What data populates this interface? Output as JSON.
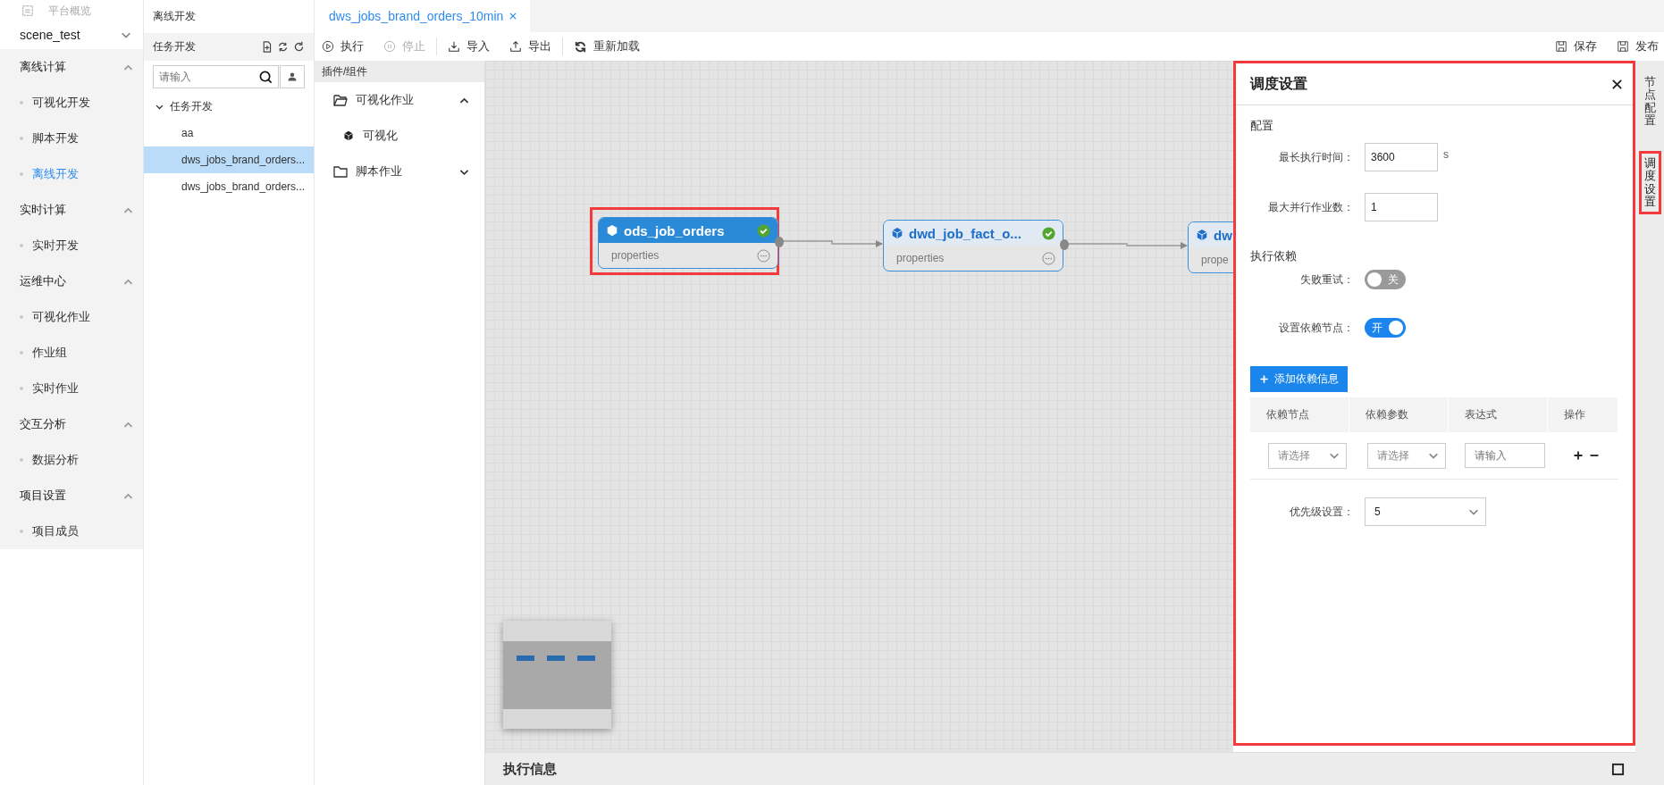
{
  "nav": {
    "overview": {
      "label": "平台概览",
      "disabled": true
    },
    "project": {
      "value": "scene_test"
    },
    "groups": [
      {
        "label": "离线计算",
        "expanded": true,
        "items": [
          {
            "label": "可视化开发",
            "selected": false
          },
          {
            "label": "脚本开发",
            "selected": false
          },
          {
            "label": "离线开发",
            "selected": true
          }
        ]
      },
      {
        "label": "实时计算",
        "expanded": true,
        "items": [
          {
            "label": "实时开发",
            "selected": false
          }
        ]
      },
      {
        "label": "运维中心",
        "expanded": true,
        "items": [
          {
            "label": "可视化作业",
            "selected": false
          },
          {
            "label": "作业组",
            "selected": false
          },
          {
            "label": "实时作业",
            "selected": false
          }
        ]
      },
      {
        "label": "交互分析",
        "expanded": true,
        "items": [
          {
            "label": "数据分析",
            "selected": false
          }
        ]
      },
      {
        "label": "项目设置",
        "expanded": true,
        "items": [
          {
            "label": "项目成员",
            "selected": false
          }
        ]
      }
    ]
  },
  "explorer": {
    "title": "离线开发",
    "section": "任务开发",
    "search": {
      "placeholder": "请输入"
    },
    "tree": [
      {
        "label": "任务开发",
        "expanded": true,
        "children": [
          {
            "label": "aa",
            "selected": false
          },
          {
            "label": "dws_jobs_brand_orders...",
            "selected": true
          },
          {
            "label": "dws_jobs_brand_orders...",
            "selected": false
          }
        ]
      }
    ]
  },
  "tabs": [
    {
      "label": "dws_jobs_brand_orders_10min",
      "selected": true
    }
  ],
  "toolbar": {
    "left": [
      [
        {
          "kind": "run",
          "label": "执行",
          "disabled": false
        },
        {
          "kind": "stop",
          "label": "停止",
          "disabled": true
        }
      ],
      [
        {
          "kind": "import",
          "label": "导入",
          "disabled": false
        },
        {
          "kind": "export",
          "label": "导出",
          "disabled": false
        }
      ],
      [
        {
          "kind": "reload",
          "label": "重新加载",
          "disabled": false
        }
      ]
    ],
    "right": [
      {
        "label": "保存"
      },
      {
        "label": "发布"
      }
    ]
  },
  "plugins": {
    "title": "插件/组件",
    "groups": [
      {
        "label": "可视化作业",
        "expanded": true,
        "items": [
          {
            "label": "可视化"
          }
        ]
      },
      {
        "label": "脚本作业",
        "expanded": false
      }
    ]
  },
  "canvas": {
    "nodes": [
      {
        "title": "ods_job_orders",
        "subtitle": "properties",
        "selected": true,
        "done": true,
        "highlighted": true
      },
      {
        "title": "dwd_job_fact_o...",
        "subtitle": "properties",
        "selected": false,
        "done": true
      },
      {
        "title": "dw",
        "subtitle": "prope",
        "selected": false
      }
    ]
  },
  "schedule_panel": {
    "title": "调度设置",
    "highlighted": true,
    "config_heading": "配置",
    "fields": [
      {
        "label": "最长执行时间：",
        "value": "3600",
        "unit": "s"
      },
      {
        "label": "最大并行作业数：",
        "value": "1"
      }
    ],
    "dependency_heading": "执行依赖",
    "toggles": [
      {
        "label": "失败重试：",
        "on": false,
        "text": "关"
      },
      {
        "label": "设置依赖节点：",
        "on": true,
        "text": "开"
      }
    ],
    "add_button": "添加依赖信息",
    "table": {
      "columns": [
        "依赖节点",
        "依赖参数",
        "表达式",
        "操作"
      ],
      "rows": [
        {
          "node": {
            "placeholder": "请选择"
          },
          "param": {
            "placeholder": "请选择"
          },
          "expression": {
            "placeholder": "请输入"
          }
        }
      ]
    },
    "priority": {
      "label": "优先级设置：",
      "value": "5"
    }
  },
  "side_tabs": [
    {
      "label": "节点配置",
      "selected": false,
      "highlighted": false
    },
    {
      "label": "调度设置",
      "selected": true,
      "highlighted": true
    }
  ],
  "bottom_panel": {
    "title": "执行信息"
  }
}
